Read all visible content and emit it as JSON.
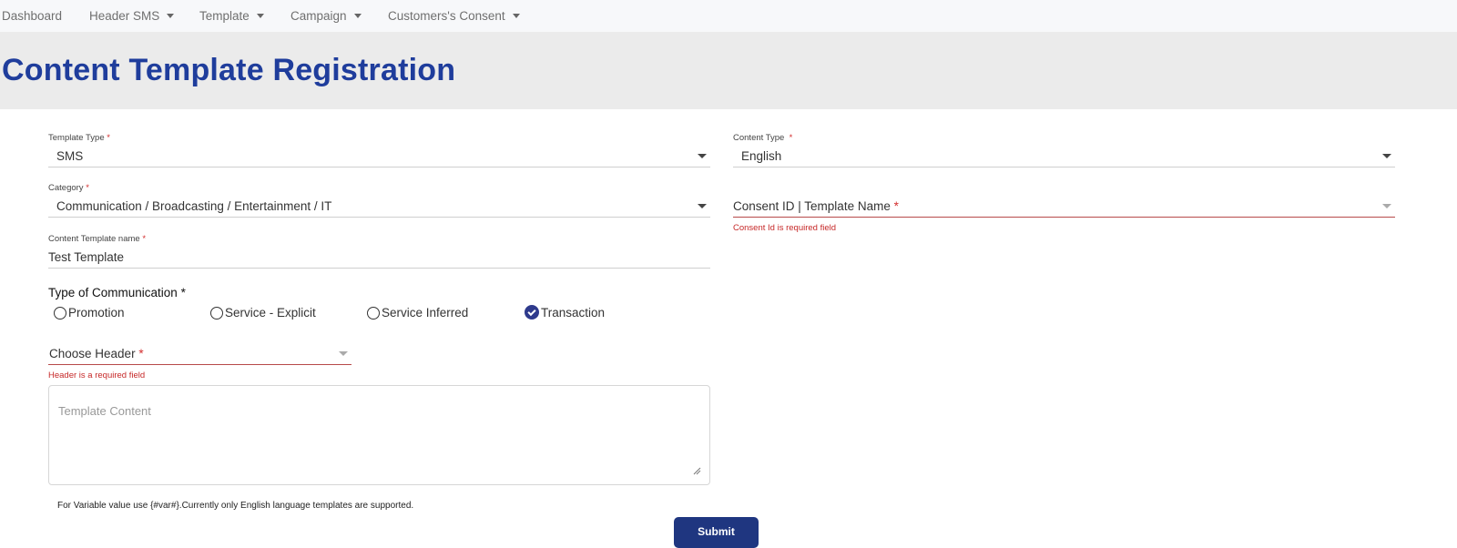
{
  "nav": {
    "items": [
      {
        "label": "Dashboard",
        "has_caret": false
      },
      {
        "label": "Header SMS",
        "has_caret": true
      },
      {
        "label": "Template",
        "has_caret": true
      },
      {
        "label": "Campaign",
        "has_caret": true
      },
      {
        "label": "Customers's Consent",
        "has_caret": true
      }
    ]
  },
  "page": {
    "title": "Content Template Registration"
  },
  "form": {
    "template_type": {
      "label": "Template Type",
      "required_mark": "*",
      "value": "SMS"
    },
    "content_type": {
      "label": "Content Type",
      "required_mark": "*",
      "value": "English"
    },
    "category": {
      "label": "Category",
      "required_mark": "*",
      "value": "Communication / Broadcasting / Entertainment / IT"
    },
    "consent_id": {
      "label": "Consent ID | Template Name",
      "required_mark": "*",
      "value": "",
      "error": "Consent Id is required field"
    },
    "content_template_name": {
      "label": "Content Template name",
      "required_mark": "*",
      "value": "Test Template"
    },
    "communication_type": {
      "heading": "Type of Communication *",
      "options": [
        {
          "label": "Promotion",
          "checked": false
        },
        {
          "label": "Service - Explicit",
          "checked": false
        },
        {
          "label": "Service Inferred",
          "checked": false
        },
        {
          "label": "Transaction",
          "checked": true
        }
      ]
    },
    "header": {
      "label": "Choose Header",
      "required_mark": "*",
      "value": "",
      "error": "Header is a required field"
    },
    "template_content": {
      "placeholder": "Template Content",
      "value": ""
    },
    "hint": "For Variable value use {#var#}.Currently only English language templates are supported.",
    "submit_label": "Submit"
  },
  "colors": {
    "title": "#1f3d9c",
    "error": "#c62828",
    "radio_checked": "#2e3a8c",
    "submit_bg": "#1f3680"
  }
}
